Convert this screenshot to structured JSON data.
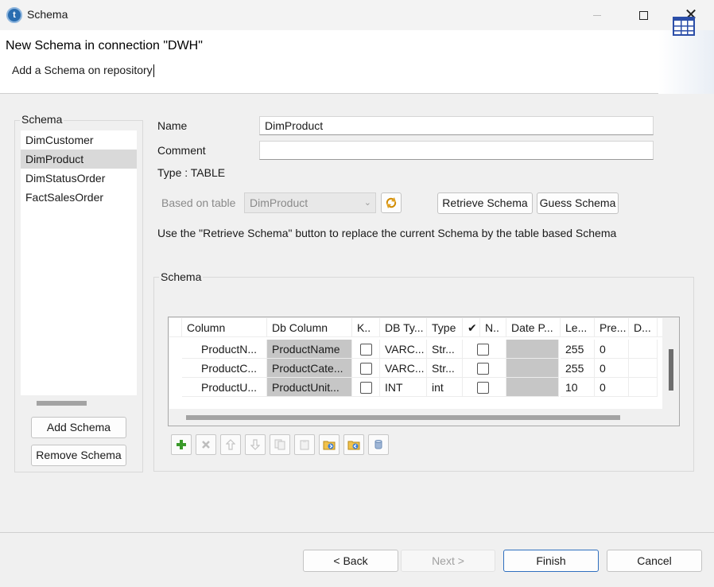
{
  "window": {
    "title": "Schema"
  },
  "header": {
    "title": "New Schema in connection \"DWH\"",
    "description": "Add a Schema on repository"
  },
  "left_panel": {
    "group_label": "Schema",
    "items": [
      "DimCustomer",
      "DimProduct",
      "DimStatusOrder",
      "FactSalesOrder"
    ],
    "selected": "DimProduct",
    "add_button": "Add Schema",
    "remove_button": "Remove Schema"
  },
  "form": {
    "name_label": "Name",
    "name_value": "DimProduct",
    "comment_label": "Comment",
    "comment_value": "",
    "type_label": "Type : TABLE",
    "based_on_label": "Based on table",
    "based_on_value": "DimProduct",
    "retrieve_button": "Retrieve Schema",
    "guess_button": "Guess Schema",
    "info_text": "Use the \"Retrieve Schema\" button to replace the current Schema by the table based Schema"
  },
  "schema_table": {
    "group_label": "Schema",
    "headers": [
      "Column",
      "Db Column",
      "K..",
      "DB Ty...",
      "Type",
      "✔",
      "N..",
      "Date P...",
      "Le...",
      "Pre...",
      "D...",
      ""
    ],
    "rows": [
      {
        "column": "ProductN...",
        "db_column": "ProductName",
        "key": false,
        "db_type": "VARC...",
        "type": "Str...",
        "nullable": false,
        "date_pattern": "",
        "length": "255",
        "precision": "0",
        "default": ""
      },
      {
        "column": "ProductC...",
        "db_column": "ProductCate...",
        "key": false,
        "db_type": "VARC...",
        "type": "Str...",
        "nullable": false,
        "date_pattern": "",
        "length": "255",
        "precision": "0",
        "default": ""
      },
      {
        "column": "ProductU...",
        "db_column": "ProductUnit...",
        "key": false,
        "db_type": "INT",
        "type": "int",
        "nullable": false,
        "date_pattern": "",
        "length": "10",
        "precision": "0",
        "default": ""
      }
    ]
  },
  "toolbar_icons": [
    "add-row-icon",
    "remove-row-icon",
    "move-up-icon",
    "move-down-icon",
    "copy-icon",
    "paste-icon",
    "import-icon",
    "export-icon",
    "database-icon"
  ],
  "footer": {
    "back": "< Back",
    "next": "Next >",
    "finish": "Finish",
    "cancel": "Cancel"
  }
}
